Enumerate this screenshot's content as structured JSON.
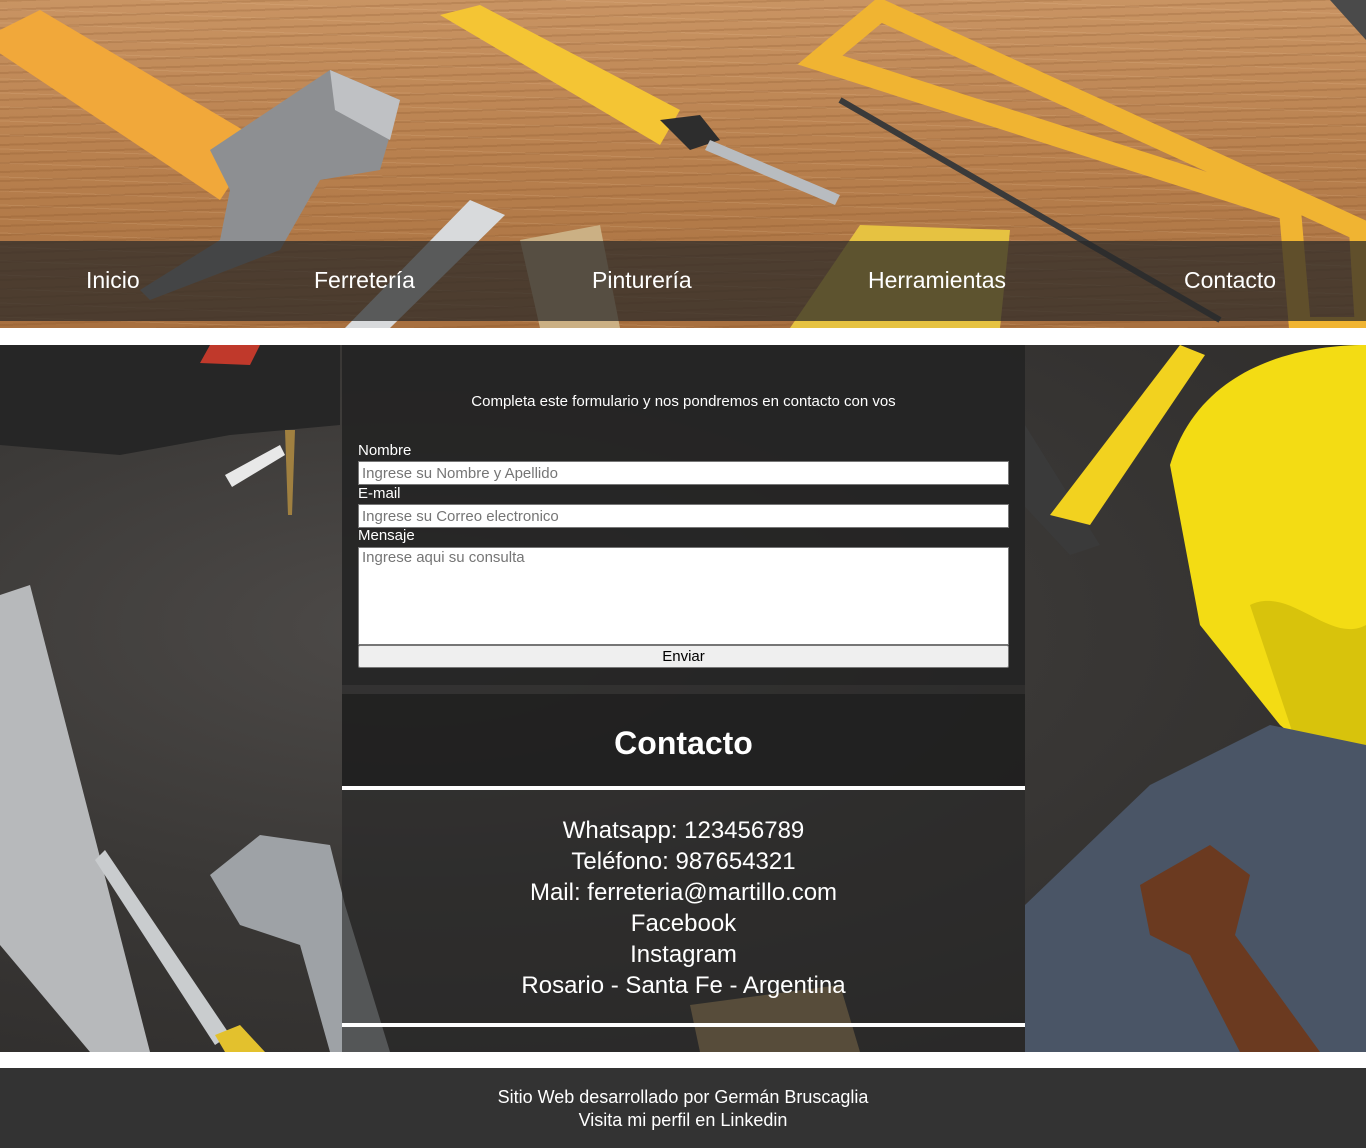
{
  "nav": {
    "items": [
      {
        "label": "Inicio"
      },
      {
        "label": "Ferretería"
      },
      {
        "label": "Pinturería"
      },
      {
        "label": "Herramientas"
      },
      {
        "label": "Contacto"
      }
    ]
  },
  "form": {
    "intro": "Completa este formulario y nos pondremos en contacto con vos",
    "name_label": "Nombre",
    "name_placeholder": "Ingrese su Nombre y Apellido",
    "email_label": "E-mail",
    "email_placeholder": "Ingrese su Correo electronico",
    "message_label": "Mensaje",
    "message_placeholder": "Ingrese aqui su consulta",
    "submit_label": "Enviar"
  },
  "contact": {
    "title": "Contacto",
    "lines": [
      "Whatsapp: 123456789",
      "Teléfono: 987654321",
      "Mail: ferreteria@martillo.com",
      "Facebook",
      "Instagram",
      "Rosario - Santa Fe - Argentina"
    ]
  },
  "footer": {
    "credit": "Sitio Web desarrollado por Germán Bruscaglia",
    "linkedin": "Visita mi perfil en Linkedin"
  },
  "colors": {
    "nav_bar": "#282828",
    "form_panel": "#222222",
    "footer": "#333333",
    "tool_yellow": "#f2b632"
  }
}
